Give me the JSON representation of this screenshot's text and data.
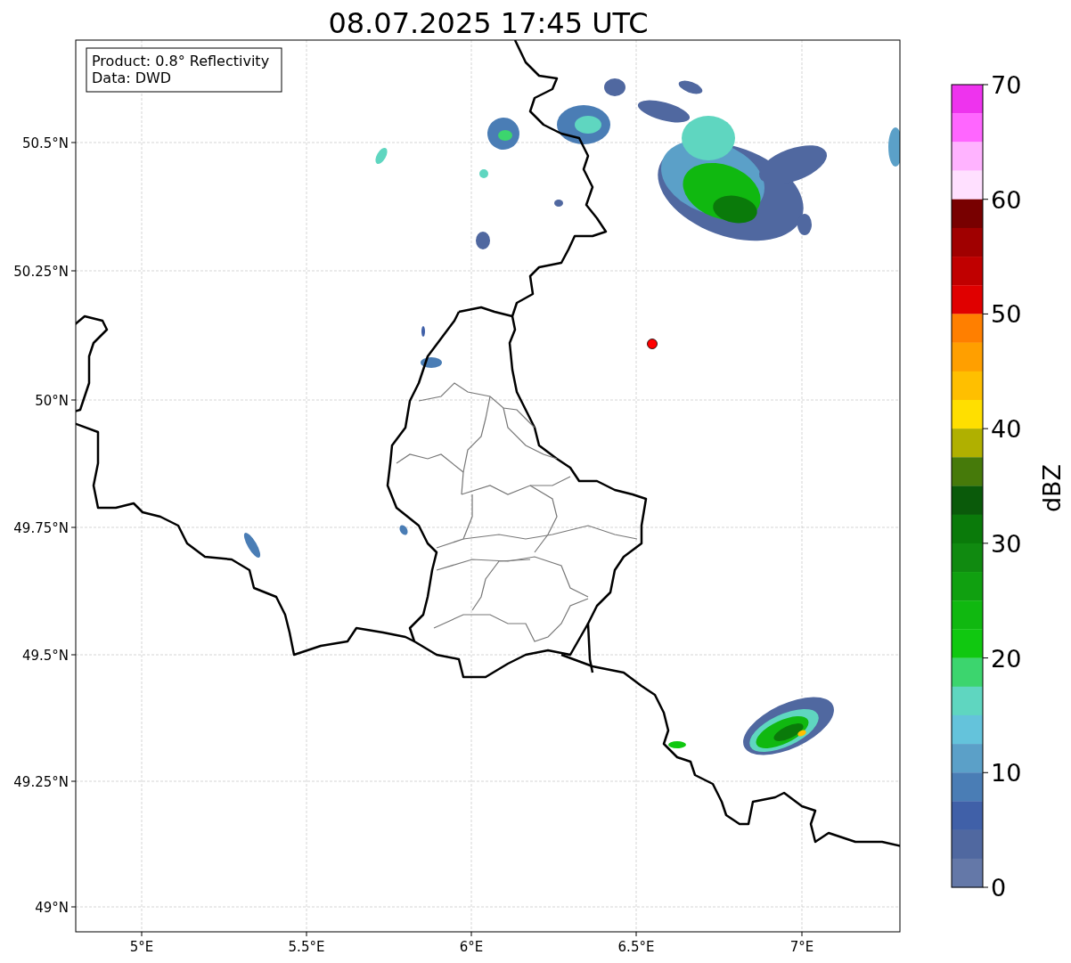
{
  "title": "08.07.2025 17:45 UTC",
  "legend": [
    "Product: 0.8° Reflectivity",
    "Data: DWD"
  ],
  "x_ticks": [
    "5°E",
    "5.5°E",
    "6°E",
    "6.5°E",
    "7°E"
  ],
  "y_ticks": [
    "50.5°N",
    "50.25°N",
    "50°N",
    "49.75°N",
    "49.5°N",
    "49.25°N",
    "49°N"
  ],
  "colorbar": {
    "label": "dBZ",
    "ticks": [
      "70",
      "60",
      "50",
      "40",
      "30",
      "20",
      "10",
      "0"
    ],
    "bins": [
      {
        "color": "#ee33ee"
      },
      {
        "color": "#ff66ff"
      },
      {
        "color": "#ffb3ff"
      },
      {
        "color": "#ffe0ff"
      },
      {
        "color": "#780000"
      },
      {
        "color": "#a00000"
      },
      {
        "color": "#c00000"
      },
      {
        "color": "#e00000"
      },
      {
        "color": "#ff7f00"
      },
      {
        "color": "#ff9f00"
      },
      {
        "color": "#ffbf00"
      },
      {
        "color": "#ffdf00"
      },
      {
        "color": "#b0b000"
      },
      {
        "color": "#467a0a"
      },
      {
        "color": "#0a5a0a"
      },
      {
        "color": "#0a7a0a"
      },
      {
        "color": "#108a10"
      },
      {
        "color": "#10a010"
      },
      {
        "color": "#10b810"
      },
      {
        "color": "#10c810"
      },
      {
        "color": "#3cd56e"
      },
      {
        "color": "#5fd6c0"
      },
      {
        "color": "#64c3db"
      },
      {
        "color": "#5ba0c8"
      },
      {
        "color": "#4a7db5"
      },
      {
        "color": "#4060a8"
      },
      {
        "color": "#5068a0"
      },
      {
        "color": "#6478a8"
      }
    ]
  }
}
